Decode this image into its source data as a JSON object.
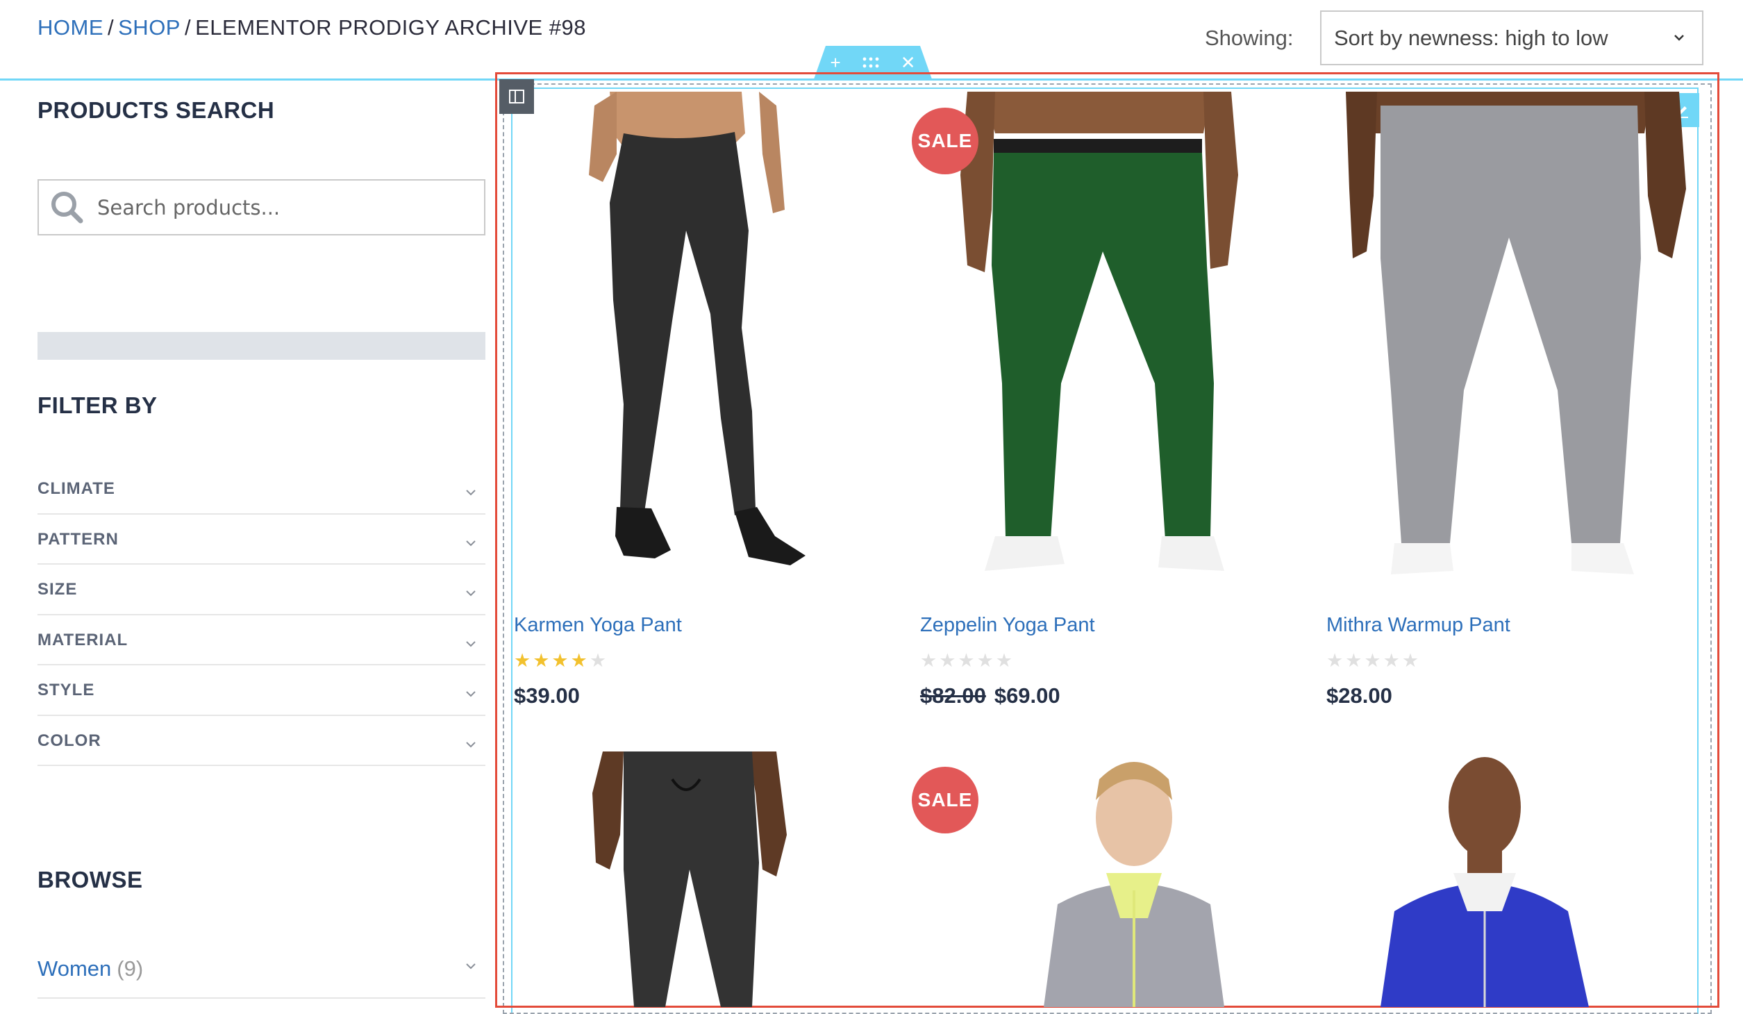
{
  "breadcrumb": {
    "home": "HOME",
    "shop": "SHOP",
    "separator": "/",
    "current": "ELEMENTOR PRODIGY ARCHIVE #98"
  },
  "sort": {
    "label": "Showing:",
    "selected": "Sort by newness: high to low"
  },
  "sidebar": {
    "search_heading": "PRODUCTS SEARCH",
    "search_placeholder": "Search products...",
    "filter_heading": "FILTER BY",
    "filters": [
      "CLIMATE",
      "PATTERN",
      "SIZE",
      "MATERIAL",
      "STYLE",
      "COLOR"
    ],
    "browse_heading": "BROWSE",
    "browse_items": [
      {
        "label": "Women",
        "count": "(9)"
      }
    ]
  },
  "products": [
    {
      "name": "Karmen Yoga Pant",
      "rating": 4,
      "price": "$39.00",
      "old_price": "",
      "sale": false
    },
    {
      "name": "Zeppelin Yoga Pant",
      "rating": 0,
      "price": "$69.00",
      "old_price": "$82.00",
      "sale": true
    },
    {
      "name": "Mithra Warmup Pant",
      "rating": 0,
      "price": "$28.00",
      "old_price": "",
      "sale": false
    },
    {
      "name": "",
      "rating": 0,
      "price": "",
      "old_price": "",
      "sale": false
    },
    {
      "name": "",
      "rating": 0,
      "price": "",
      "old_price": "",
      "sale": true
    },
    {
      "name": "",
      "rating": 0,
      "price": "",
      "old_price": "",
      "sale": false
    }
  ],
  "sale_badge_text": "SALE",
  "editor": {
    "handle_icons": [
      "plus-icon",
      "drag-icon",
      "close-icon"
    ],
    "accent_color": "#71d7f7",
    "selection_color": "#e34b3a"
  },
  "colors": {
    "link": "#2d6fba",
    "sale": "#e25858",
    "star": "#f2c12e"
  }
}
